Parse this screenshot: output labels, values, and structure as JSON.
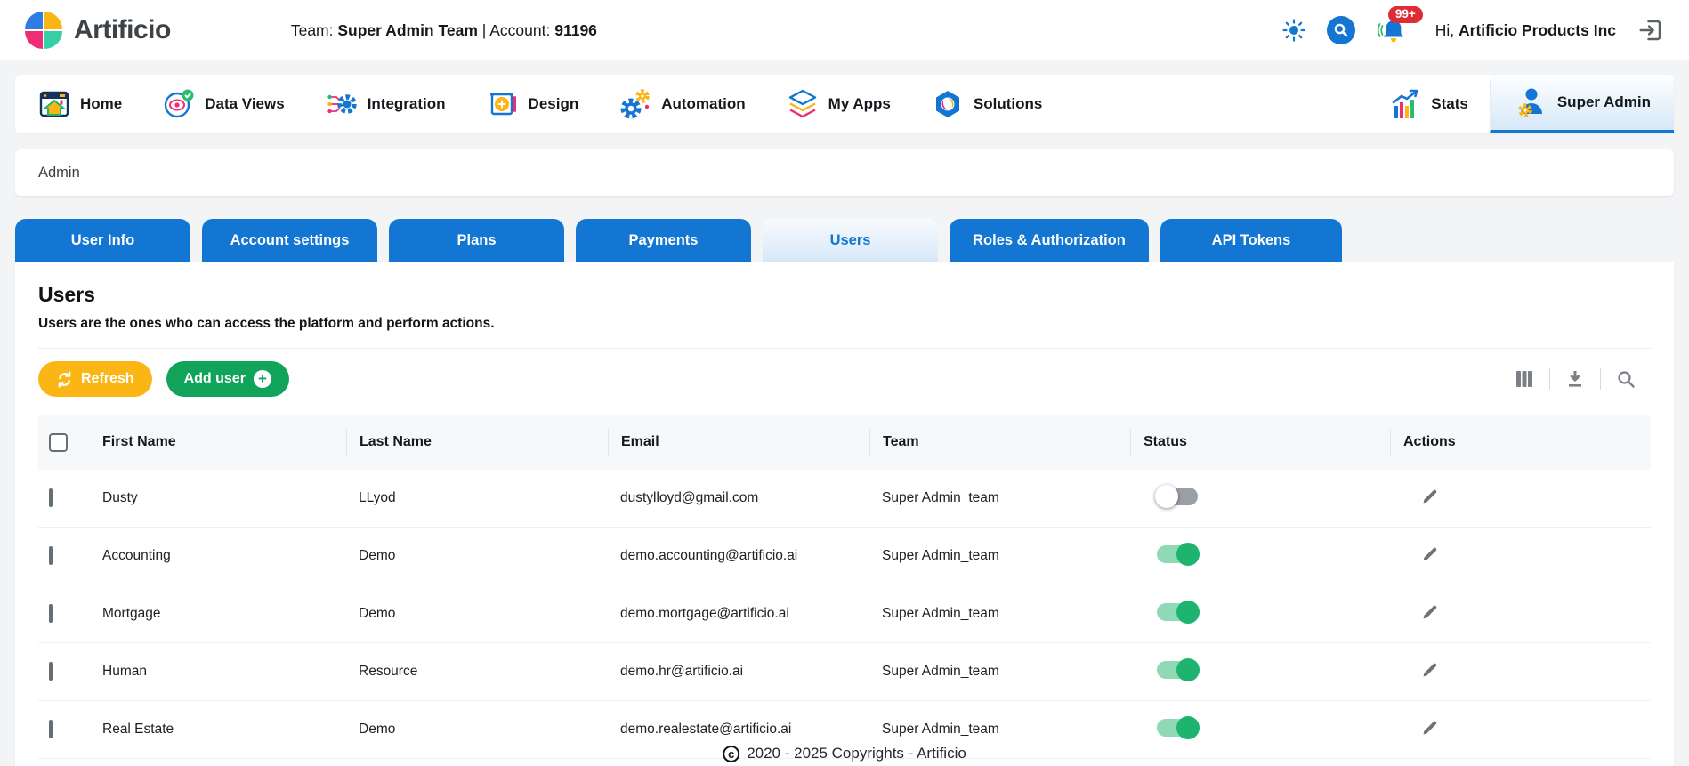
{
  "header": {
    "brand": "Artificio",
    "team_label": "Team:",
    "team_value": "Super Admin Team",
    "separator": "|",
    "account_label": "Account:",
    "account_value": "91196",
    "notification_badge": "99+",
    "greeting_prefix": "Hi,",
    "greeting_name": "Artificio Products Inc"
  },
  "nav": {
    "items": [
      {
        "label": "Home",
        "icon": "home-icon"
      },
      {
        "label": "Data Views",
        "icon": "data-views-icon"
      },
      {
        "label": "Integration",
        "icon": "integration-icon"
      },
      {
        "label": "Design",
        "icon": "design-icon"
      },
      {
        "label": "Automation",
        "icon": "automation-icon"
      },
      {
        "label": "My Apps",
        "icon": "my-apps-icon"
      },
      {
        "label": "Solutions",
        "icon": "solutions-icon"
      }
    ],
    "right": [
      {
        "label": "Stats",
        "icon": "stats-icon",
        "active": false
      },
      {
        "label": "Super Admin",
        "icon": "super-admin-icon",
        "active": true
      }
    ]
  },
  "breadcrumb": {
    "label": "Admin"
  },
  "tabs": [
    {
      "label": "User Info",
      "active": false
    },
    {
      "label": "Account settings",
      "active": false
    },
    {
      "label": "Plans",
      "active": false
    },
    {
      "label": "Payments",
      "active": false
    },
    {
      "label": "Users",
      "active": true
    },
    {
      "label": "Roles & Authorization",
      "active": false
    },
    {
      "label": "API Tokens",
      "active": false
    }
  ],
  "users_section": {
    "title": "Users",
    "description": "Users are the ones who can access the platform and perform actions.",
    "refresh_label": "Refresh",
    "add_user_label": "Add user"
  },
  "table": {
    "columns": [
      "First Name",
      "Last Name",
      "Email",
      "Team",
      "Status",
      "Actions"
    ],
    "rows": [
      {
        "first_name": "Dusty",
        "last_name": "LLyod",
        "email": "dustylloyd@gmail.com",
        "team": "Super Admin_team",
        "status_on": false
      },
      {
        "first_name": "Accounting",
        "last_name": "Demo",
        "email": "demo.accounting@artificio.ai",
        "team": "Super Admin_team",
        "status_on": true
      },
      {
        "first_name": "Mortgage",
        "last_name": "Demo",
        "email": "demo.mortgage@artificio.ai",
        "team": "Super Admin_team",
        "status_on": true
      },
      {
        "first_name": "Human",
        "last_name": "Resource",
        "email": "demo.hr@artificio.ai",
        "team": "Super Admin_team",
        "status_on": true
      },
      {
        "first_name": "Real Estate",
        "last_name": "Demo",
        "email": "demo.realestate@artificio.ai",
        "team": "Super Admin_team",
        "status_on": true
      }
    ]
  },
  "footer": {
    "copyright_symbol": "c",
    "text": "2020 - 2025 Copyrights - Artificio"
  },
  "colors": {
    "accent_blue": "#1276d2",
    "refresh_orange": "#fbb615",
    "add_user_green": "#12a35b",
    "toggle_on_green": "#1db470",
    "badge_red": "#e02b35",
    "pink": "#ef2d74",
    "yellow": "#fbb615",
    "teal": "#35d0a5"
  }
}
